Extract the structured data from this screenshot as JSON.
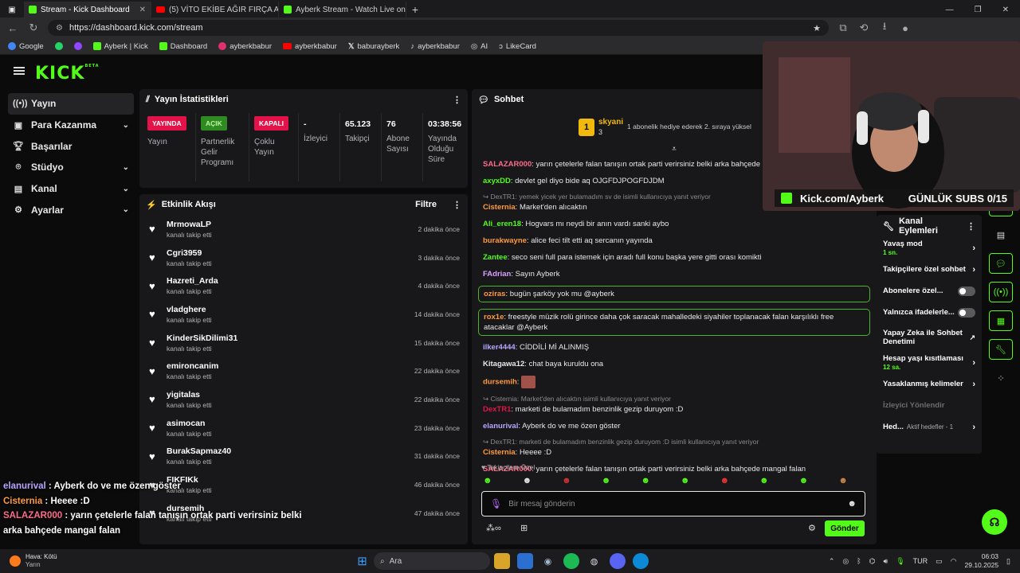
{
  "browser": {
    "tabs": [
      {
        "title": "Stream - Kick Dashboard",
        "favicon": "kick"
      },
      {
        "title": "(5) VİTO EKİBE AĞIR FIRÇA ATIYOR",
        "favicon": "youtube"
      },
      {
        "title": "Ayberk Stream - Watch Live on Kick",
        "favicon": "kick"
      }
    ],
    "url": "https://dashboard.kick.com/stream",
    "bookmarks": [
      "Google",
      "Ayberk | Kick",
      "Dashboard",
      "ayberkbabur",
      "ayberkbabur",
      "baburayberk",
      "ayberkbabur",
      "AI",
      "LikeCard"
    ]
  },
  "sidebar": {
    "items": [
      {
        "label": "Yayın",
        "icon": "broadcast-icon",
        "expandable": false
      },
      {
        "label": "Para Kazanma",
        "icon": "money-icon",
        "expandable": true
      },
      {
        "label": "Başarılar",
        "icon": "trophy-icon",
        "expandable": false
      },
      {
        "label": "Stüdyo",
        "icon": "studio-icon",
        "expandable": true
      },
      {
        "label": "Kanal",
        "icon": "channel-icon",
        "expandable": true
      },
      {
        "label": "Ayarlar",
        "icon": "gear-icon",
        "expandable": true
      }
    ]
  },
  "stats": {
    "title": "Yayın İstatistikleri",
    "cells": [
      {
        "badge": "YAYINDA",
        "badge_color": "#e3134a",
        "label": "Yayın"
      },
      {
        "badge": "AÇIK",
        "badge_color": "#2f8a22",
        "label": "Partnerlik Gelir Programı"
      },
      {
        "badge": "KAPALI",
        "badge_color": "#e3134a",
        "label": "Çoklu Yayın"
      },
      {
        "value": "-",
        "label": "İzleyici"
      },
      {
        "value": "65.123",
        "label": "Takipçi"
      },
      {
        "value": "76",
        "label": "Abone Sayısı"
      },
      {
        "value": "03:38:56",
        "label": "Yayında Olduğu Süre"
      }
    ]
  },
  "activity": {
    "title": "Etkinlik Akışı",
    "filter_label": "Filtre",
    "items": [
      {
        "name": "MrmowaLP",
        "action": "kanalı takip etti",
        "time": "2 dakika önce"
      },
      {
        "name": "Cgri3959",
        "action": "kanalı takip etti",
        "time": "3 dakika önce"
      },
      {
        "name": "Hazreti_Arda",
        "action": "kanalı takip etti",
        "time": "4 dakika önce"
      },
      {
        "name": "vladghere",
        "action": "kanalı takip etti",
        "time": "14 dakika önce"
      },
      {
        "name": "KinderSikDilimi31",
        "action": "kanalı takip etti",
        "time": "15 dakika önce"
      },
      {
        "name": "emironcanim",
        "action": "kanalı takip etti",
        "time": "22 dakika önce"
      },
      {
        "name": "yigitalas",
        "action": "kanalı takip etti",
        "time": "22 dakika önce"
      },
      {
        "name": "asimocan",
        "action": "kanalı takip etti",
        "time": "23 dakika önce"
      },
      {
        "name": "BurakSapmaz40",
        "action": "kanalı takip etti",
        "time": "31 dakika önce"
      },
      {
        "name": "FIKFIKk",
        "action": "kanalı takip etti",
        "time": "46 dakika önce"
      },
      {
        "name": "dursemih",
        "action": "kanalı takip etti",
        "time": "47 dakika önce"
      }
    ]
  },
  "chat": {
    "title": "Sohbet",
    "pinned": {
      "user": "skyani",
      "count": "3",
      "rank": "1",
      "text": "1 abonelik hediye ederek 2. sıraya yüksel"
    },
    "messages": [
      {
        "user": "SALAZAR000",
        "color": "#ff6b8a",
        "text": "yarın çetelerle falan tanışın ortak parti verirsiniz belki arka bahçede ma"
      },
      {
        "user": "axyxDD",
        "color": "#53fc18",
        "text": "devlet gel diyo bide aq OJGFDJPOGFDJDM"
      },
      {
        "reply": "DexTR1: yemek yicek yer bulamadım sv de isimli kullanıcıya yanıt veriyor",
        "user": "Cisternia",
        "color": "#ff9a3c",
        "text": "Market'den alıcaktın"
      },
      {
        "user": "Ali_eren18",
        "color": "#53fc18",
        "text": "Hogvars mı neydi bir anın vardı sanki aybo"
      },
      {
        "user": "burakwayne",
        "color": "#ff9a3c",
        "text": "alice feci tilt etti aq sercanın yayında"
      },
      {
        "user": "Zantee",
        "color": "#53fc18",
        "text": "seco seni full para istemek için aradı full konu başka yere gitti orası komikti"
      },
      {
        "user": "FAdrian",
        "color": "#d9a0ff",
        "text": "Sayın Ayberk"
      },
      {
        "user": "oziras",
        "color": "#ff9a3c",
        "text": "bugün şarköy yok mu @ayberk",
        "highlight": true
      },
      {
        "user": "rox1e",
        "color": "#ff9a3c",
        "text": "freestyle müzik rolü girince daha çok saracak mahalledeki siyahiler toplanacak falan karşılıklı free atacaklar @Ayberk",
        "highlight": true
      },
      {
        "user": "ilker4444",
        "color": "#b8a6ff",
        "text": "CİDDİLİ Mİ ALINMIŞ"
      },
      {
        "user": "Kitagawa12",
        "color": "#e8e8e8",
        "text": "chat baya kuruldu ona"
      },
      {
        "user": "dursemih",
        "color": "#ff9a3c",
        "text": ""
      },
      {
        "reply": "Cisternia: Market'den alıcaktın isimli kullanıcıya yanıt veriyor",
        "user": "DexTR1",
        "color": "#e3134a",
        "text": "marketi de bulamadım benzinlik gezip duruyom :D"
      },
      {
        "user": "elanurival",
        "color": "#b8a6ff",
        "text": "Ayberk do ve me özen göster"
      },
      {
        "reply": "DexTR1: marketi de bulamadım benzinlik gezip duruyom :D isimli kullanıcıya yanıt veriyor",
        "user": "Cisternia",
        "color": "#ff9a3c",
        "text": "Heeee :D"
      },
      {
        "user": "SALAZAR000",
        "color": "#ff6b8a",
        "text": "yarın çetelerle falan tanışın ortak parti verirsiniz belki arka bahçede mangal falan"
      }
    ],
    "followers_only_label": "Takipçilere Özel",
    "input_placeholder": "Bir mesaj gönderin",
    "send_label": "Gönder"
  },
  "channel_actions": {
    "title": "Kanal Eylemleri",
    "items": [
      {
        "label": "Yavaş mod",
        "sub": "1 sn.",
        "control": "chevron"
      },
      {
        "label": "Takipçilere özel sohbet",
        "sub": "",
        "control": "chevron"
      },
      {
        "label": "Abonelere özel...",
        "sub": "",
        "control": "toggle"
      },
      {
        "label": "Yalnızca ifadelerle...",
        "sub": "",
        "control": "toggle"
      },
      {
        "label": "Yapay Zeka ile Sohbet Denetimi",
        "sub": "",
        "control": "external"
      },
      {
        "label": "Hesap yaşı kısıtlaması",
        "sub": "12 sa.",
        "control": "chevron"
      },
      {
        "label": "Yasaklanmış kelimeler",
        "sub": "",
        "control": "chevron"
      },
      {
        "label": "İzleyici Yönlendir",
        "sub": "",
        "control": "none"
      },
      {
        "label": "Hed...",
        "sub": "Aktif hedefler - 1",
        "control": "chevron"
      }
    ]
  },
  "webcam_overlay": {
    "channel": "Kick.com/Ayberk",
    "subs_goal": "GÜNLÜK SUBS 0/15"
  },
  "overlay_chat": [
    {
      "user": "elanurival",
      "color": "#b8a6ff",
      "text": "Ayberk do ve me özen göster"
    },
    {
      "user": "Cisternia",
      "color": "#ff9a3c",
      "text": "Heeee :D"
    },
    {
      "user": "SALAZAR000",
      "color": "#ff6b8a",
      "text": "yarın çetelerle falan tanışın ortak parti verirsiniz belki arka bahçede mangal falan"
    }
  ],
  "taskbar": {
    "weather_title": "Hava: Kötü",
    "weather_sub": "Yarın",
    "search_label": "Ara",
    "lang": "TUR",
    "time": "06:03",
    "date": "29.10.2025"
  },
  "colors": {
    "kick_green": "#53fc18",
    "live_red": "#e3134a",
    "panel": "#18181a"
  }
}
